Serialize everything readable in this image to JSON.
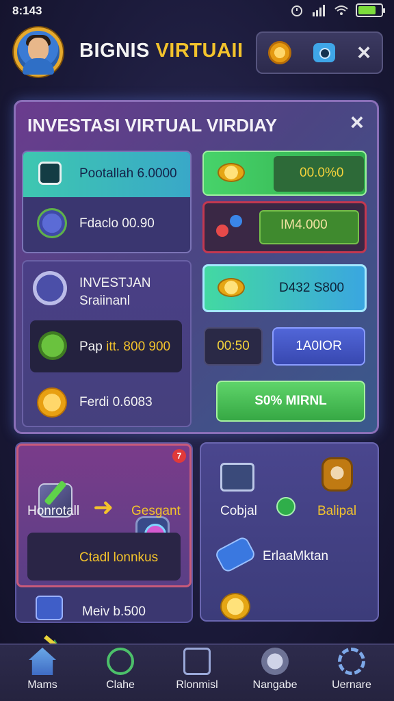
{
  "status": {
    "time": "8:143"
  },
  "header": {
    "title_part1": "BIGNIS",
    "title_part2": "VIRTUAII"
  },
  "panel": {
    "title": "INVESTASI VIRTUAL VIRDIAY",
    "left_card1": {
      "header_text": "Pootallah 6.0000",
      "row_text": "Fdaclo 00.90"
    },
    "right_buttons": {
      "green1": "00.0%0",
      "red": "IM4.000",
      "blue1": "D432 S800",
      "dark": "00:50",
      "blue2": "1A0IOR",
      "green2": "S0% MIRNL"
    },
    "left_card2": {
      "title_line1": "INVESTJAN",
      "title_line2": "Sraiinanl",
      "inset_prefix": "Pap",
      "inset_value": "itt. 800 900",
      "bottom_text": "Ferdi 0.6083"
    }
  },
  "bottom_panels": {
    "left": {
      "badge": "7",
      "label1": "Honrotall",
      "label2": "Gesgant",
      "inset_text": "Ctadl lonnkus",
      "footer_text": "Meiv b.500"
    },
    "right": {
      "label1": "Cobjal",
      "label2": "Balipal",
      "label3": "ErlaaMktan"
    }
  },
  "nav": [
    {
      "label": "Mams",
      "icon": "home-icon"
    },
    {
      "label": "Clahe",
      "icon": "search-icon"
    },
    {
      "label": "Rlonmisl",
      "icon": "edit-icon"
    },
    {
      "label": "Nangabe",
      "icon": "camera-icon"
    },
    {
      "label": "Uernare",
      "icon": "gear-icon"
    }
  ]
}
